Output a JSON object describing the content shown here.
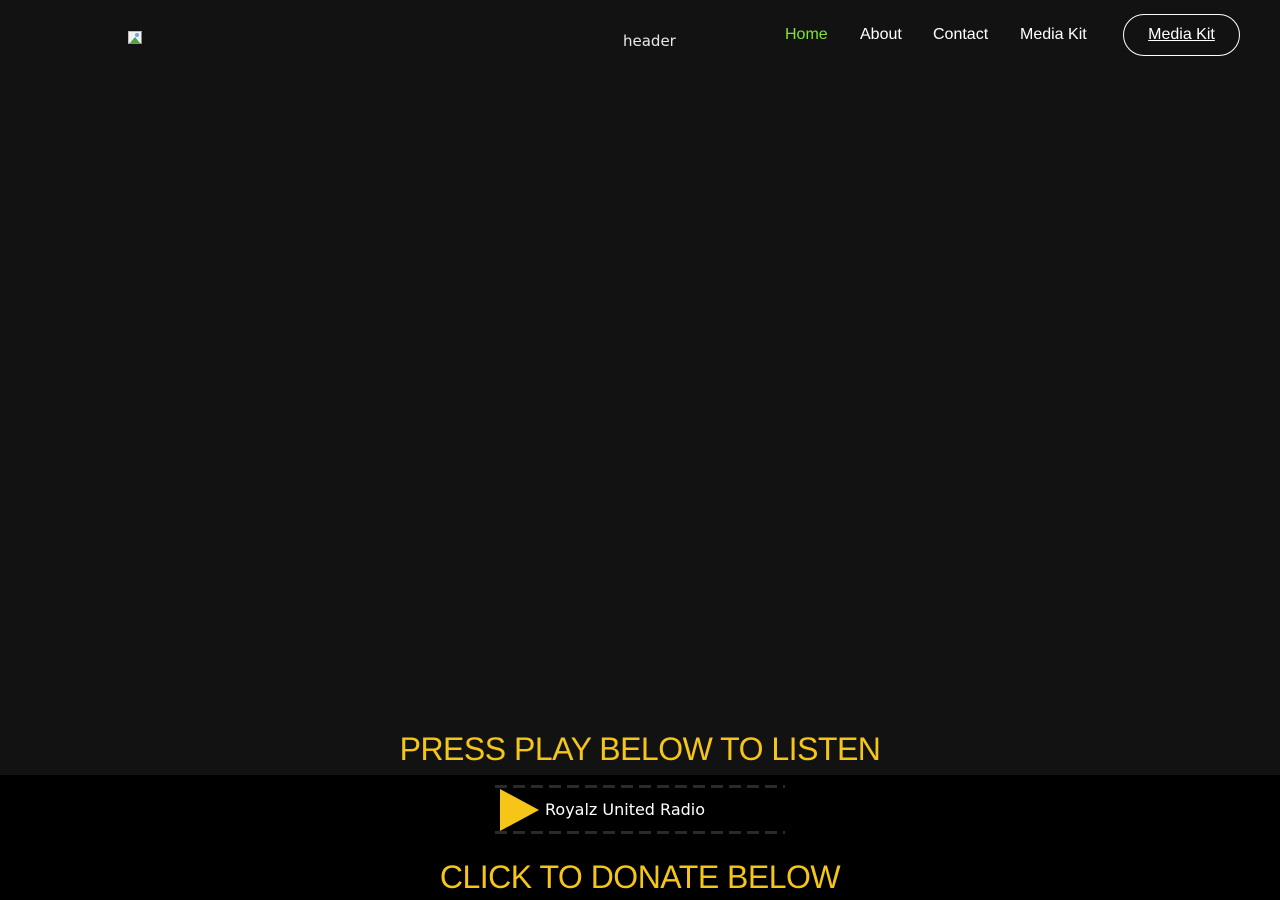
{
  "header": {
    "logo_alt": "header",
    "nav": [
      {
        "label": "Home",
        "active": true
      },
      {
        "label": "About",
        "active": false
      },
      {
        "label": "Contact",
        "active": false
      },
      {
        "label": "Media Kit",
        "active": false
      }
    ],
    "cta_label": "Media Kit"
  },
  "main": {
    "listen_heading": "PRESS PLAY BELOW TO LISTEN",
    "player": {
      "play_icon": "play-icon",
      "station_name": "Royalz United Radio"
    },
    "donate_heading": "CLICK TO DONATE BELOW"
  },
  "colors": {
    "background": "#121212",
    "player_band": "#000000",
    "accent_yellow": "#f5c518",
    "nav_active": "#7de62f",
    "text": "#ffffff"
  }
}
